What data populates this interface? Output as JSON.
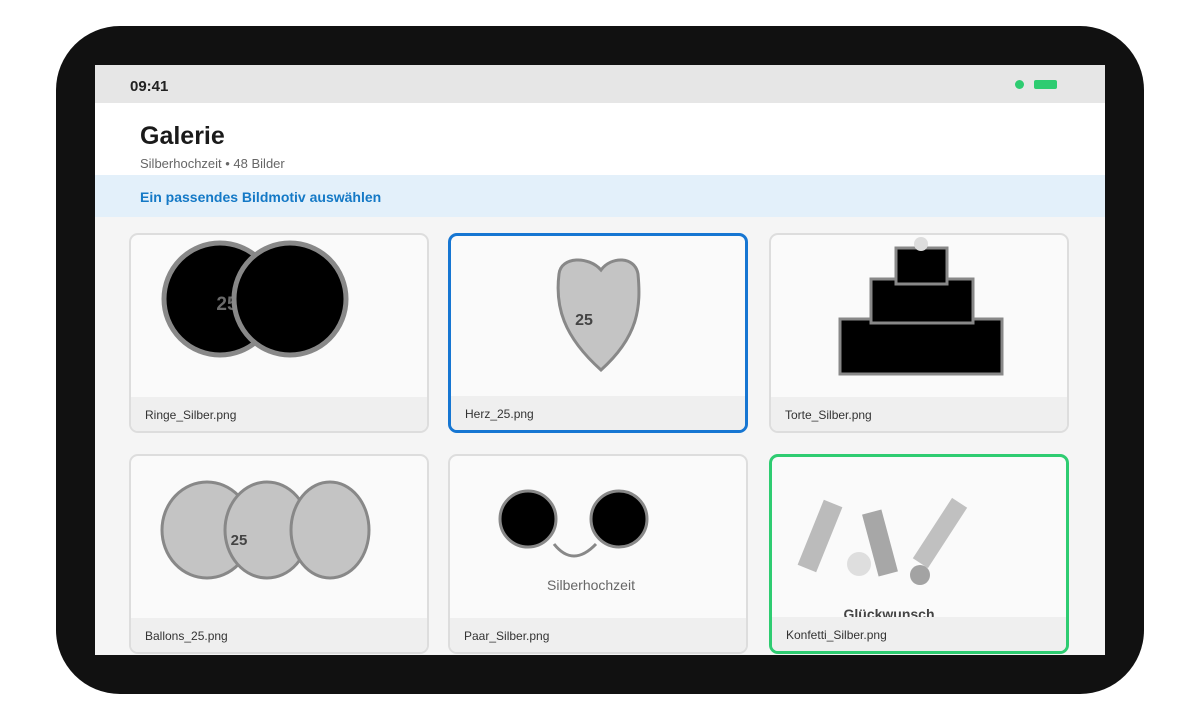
{
  "status": {
    "time": "09:41"
  },
  "header": {
    "title": "Galerie",
    "subtitle": "Silberhochzeit • 48 Bilder"
  },
  "banner": {
    "text": "Ein passendes Bildmotiv auswählen"
  },
  "colors": {
    "accent_blue": "#1676d2",
    "accent_green": "#2ecc71",
    "banner_bg": "#e3f0fa",
    "banner_text": "#1479c6"
  },
  "gallery": [
    {
      "filename": "Ringe_Silber.png",
      "motif": "rings-image",
      "art_text": "25"
    },
    {
      "filename": "Herz_25.png",
      "motif": "heart-image",
      "art_text": "25",
      "state": "selected-blue"
    },
    {
      "filename": "Torte_Silber.png",
      "motif": "cake-image"
    },
    {
      "filename": "Ballons_25.png",
      "motif": "balloons-image",
      "art_text": "25"
    },
    {
      "filename": "Paar_Silber.png",
      "motif": "couple-image",
      "art_text": "Silberhochzeit"
    },
    {
      "filename": "Konfetti_Silber.png",
      "motif": "confetti-image",
      "art_text": "Glückwunsch",
      "state": "selected-green"
    }
  ]
}
